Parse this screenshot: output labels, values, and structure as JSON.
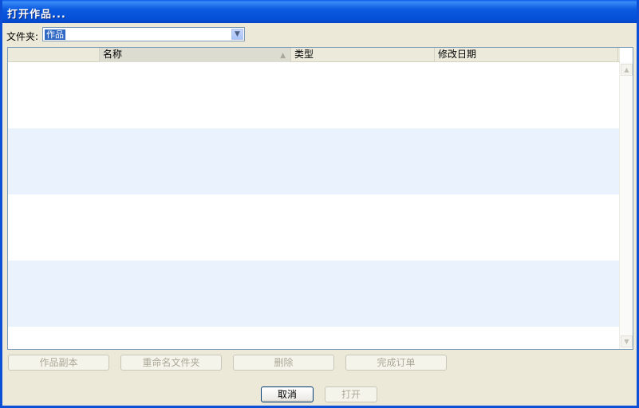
{
  "window": {
    "title": "打开作品..."
  },
  "folder": {
    "label": "文件夹:",
    "selected": "作品"
  },
  "list": {
    "columns": [
      {
        "label": ""
      },
      {
        "label": "名称"
      },
      {
        "label": "类型"
      },
      {
        "label": "修改日期"
      }
    ],
    "sorted_column": "名称",
    "rows": []
  },
  "actions": {
    "copy_label": "作品副本",
    "rename_label": "重命名文件夹",
    "delete_label": "删除",
    "complete_label": "完成订单"
  },
  "footer": {
    "cancel_label": "取消",
    "open_label": "打开"
  }
}
